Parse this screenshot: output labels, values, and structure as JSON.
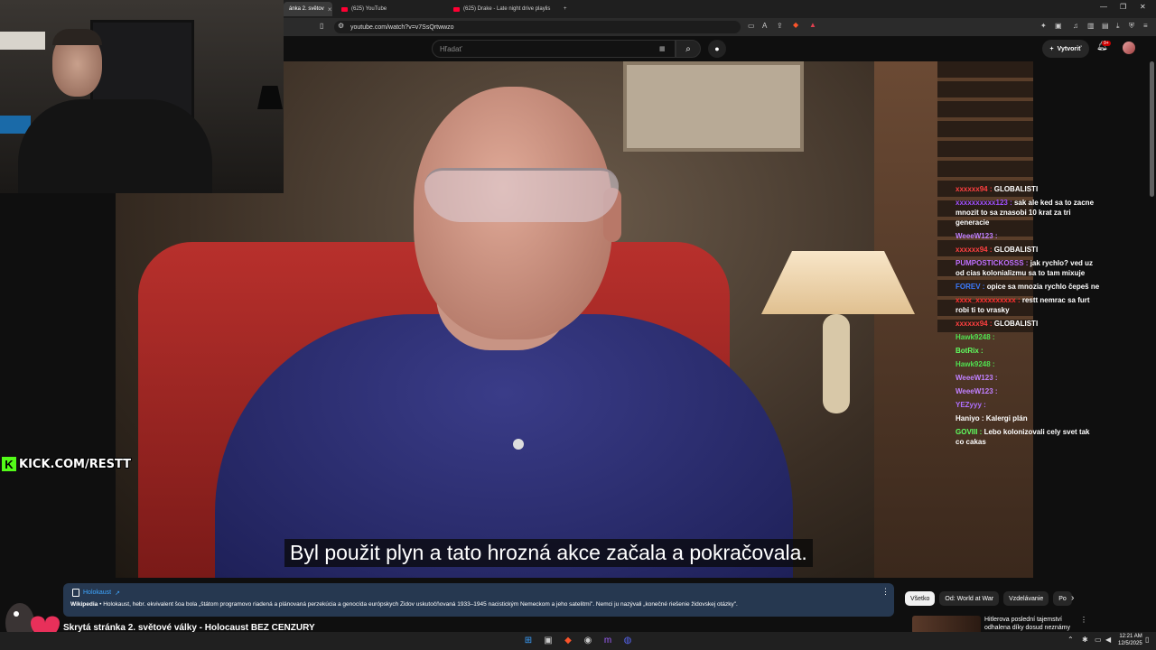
{
  "browser": {
    "tabs": [
      {
        "label": "ánka 2. světov",
        "active": true
      },
      {
        "label": "(625) YouTube",
        "active": false
      },
      {
        "label": "(625) Drake - Late night drive playlis",
        "active": false
      }
    ],
    "new_tab": "+",
    "url": "youtube.com/watch?v=v7SsQrtwwzo",
    "window_controls": [
      "—",
      "❐",
      "✕"
    ]
  },
  "youtube": {
    "search_placeholder": "Hľadať",
    "create_label": "Vytvoriť",
    "notifications": "9+"
  },
  "video": {
    "subtitle": "Byl použit plyn a tato hrozná akce začala a pokračovala."
  },
  "chat": [
    {
      "user": "xxxxxx94 :",
      "color": "#ff4040",
      "text": "GLOBALISTI"
    },
    {
      "user": "xxxxxxxxxx123 :",
      "color": "#a050ff",
      "text": "sak ale ked sa to zacne mnozit to sa znasobi 10 krat za tri generacie"
    },
    {
      "user": "WeeeW123 :",
      "color": "#c080ff",
      "text": ""
    },
    {
      "user": "xxxxxx94 :",
      "color": "#ff4040",
      "text": "GLOBALISTI"
    },
    {
      "user": "PUMPOSTICKOSSS :",
      "color": "#c070ff",
      "text": "jak rychlo? ved uz od cias kolonializmu sa to tam mixuje"
    },
    {
      "user": "FOREV :",
      "color": "#3a7aff",
      "text": "opice sa mnozia rychlo čepeš ne"
    },
    {
      "user": "xxxx_xxxxxxxxxx :",
      "color": "#ff3030",
      "text": "restt nemrac sa furt robi ti to vrasky"
    },
    {
      "user": "xxxxxx94 :",
      "color": "#ff4040",
      "text": "GLOBALISTI"
    },
    {
      "user": "Hawk9248 :",
      "color": "#50e050",
      "text": ""
    },
    {
      "user": "BotRix :",
      "color": "#60ff60",
      "text": ""
    },
    {
      "user": "Hawk9248 :",
      "color": "#50e050",
      "text": ""
    },
    {
      "user": "WeeeW123 :",
      "color": "#c080ff",
      "text": ""
    },
    {
      "user": "WeeeW123 :",
      "color": "#c080ff",
      "text": ""
    },
    {
      "user": "YEZyyy :",
      "color": "#b070ff",
      "text": ""
    },
    {
      "user": "Haniyo :",
      "color": "#ffffff",
      "text": "Kalergi plán"
    },
    {
      "user": "GOVIII :",
      "color": "#60ff60",
      "text": "Lebo kolonizovali cely svet tak co cakas"
    }
  ],
  "stream": {
    "kick_handle": "KICK.COM/RESTT"
  },
  "info_card": {
    "title": "Holokaust",
    "source": "Wikipedia",
    "body": "• Holokaust, hebr. ekvivalent šoa bola „štátom programovo riadená a plánovaná perzekúcia a genocída európskych Židov uskutočňovaná 1933–1945 nacistickým Nemeckom a jeho satelitmi\". Nemci ju nazývali „konečné riešenie židovskej otázky\"."
  },
  "video_title": "Skrytá stránka 2. světové války - Holocaust BEZ CENZURY",
  "chips": [
    "Všetko",
    "Od: World at War",
    "Vzdelávanie",
    "Po"
  ],
  "related": {
    "title": "Hitlerova poslední tajemství odhalena díky dosud neznámy"
  },
  "taskbar": {
    "time": "12:21 AM",
    "date": "12/5/2025"
  }
}
